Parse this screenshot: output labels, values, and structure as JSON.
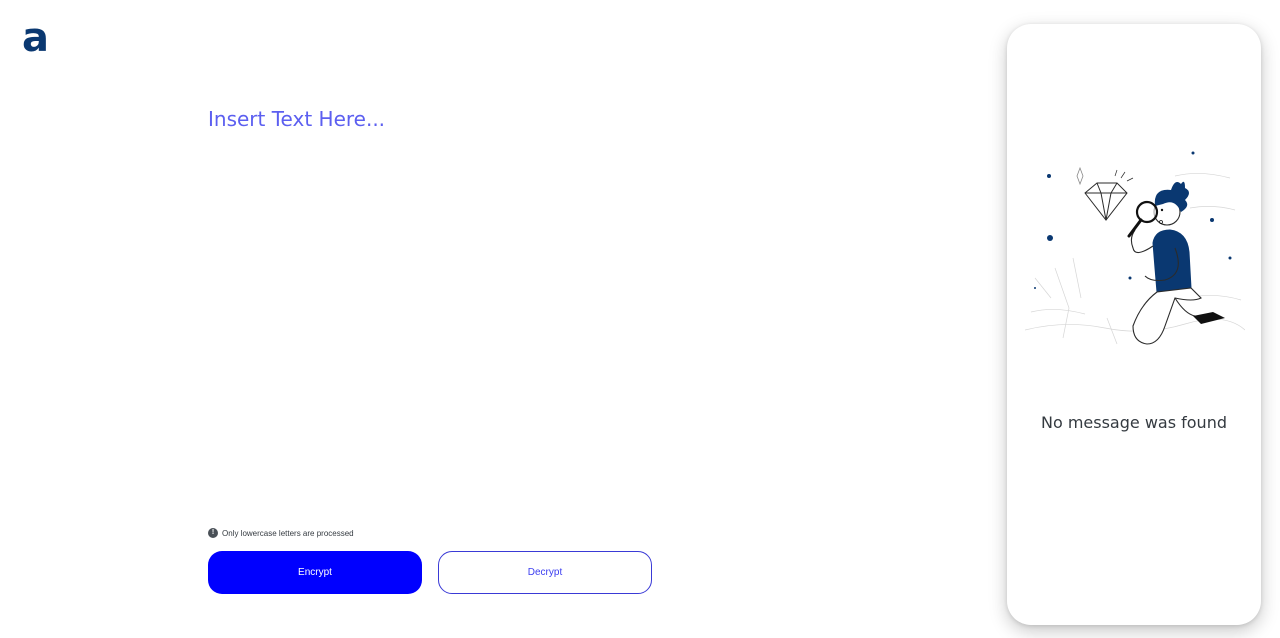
{
  "app": {
    "logo_text": "a",
    "brand_color": "#0a3871",
    "accent_color": "#0000ff"
  },
  "editor": {
    "placeholder": "Insert Text Here...",
    "value": ""
  },
  "hint": {
    "icon": "info-icon",
    "text": "Only lowercase letters are processed"
  },
  "actions": {
    "encrypt_label": "Encrypt",
    "decrypt_label": "Decrypt"
  },
  "output_panel": {
    "illustration": "person-with-magnifier-illustration",
    "empty_title": "No message was found"
  }
}
